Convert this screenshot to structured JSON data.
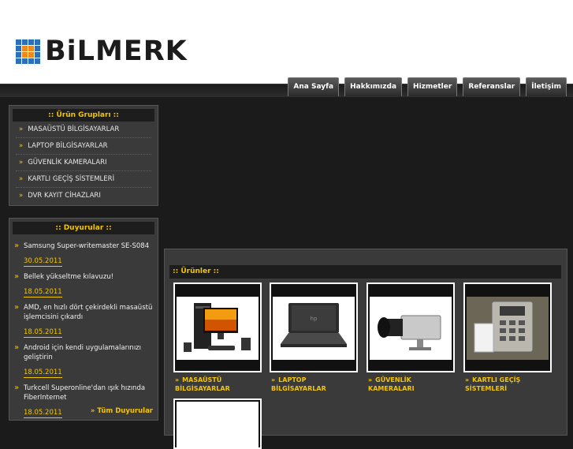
{
  "brand": {
    "name": "BiLMERK"
  },
  "nav": {
    "items": [
      {
        "label": "Ana Sayfa"
      },
      {
        "label": "Hakkımızda"
      },
      {
        "label": "Hizmetler"
      },
      {
        "label": "Referanslar"
      },
      {
        "label": "İletişim"
      }
    ]
  },
  "sidebar": {
    "products_title": ":: Ürün Grupları ::",
    "categories": [
      {
        "label": "MASAÜSTÜ BİLGİSAYARLAR"
      },
      {
        "label": "LAPTOP BİLGİSAYARLAR"
      },
      {
        "label": "GÜVENLİK KAMERALARI"
      },
      {
        "label": "KARTLI GEÇİŞ SİSTEMLERİ"
      },
      {
        "label": "DVR KAYIT CİHAZLARI"
      }
    ],
    "news_title": ":: Duyurular ::",
    "news": [
      {
        "title": "Samsung Super-writemaster SE-S084",
        "date": "30.05.2011"
      },
      {
        "title": "Bellek yükseltme kılavuzu!",
        "date": "18.05.2011"
      },
      {
        "title": "AMD, en hızlı dört çekirdekli masaüstü işlemcisini çıkardı",
        "date": "18.05.2011"
      },
      {
        "title": "Android için kendi uygulamalarınızı geliştirin",
        "date": "18.05.2011"
      },
      {
        "title": "Turkcell Superonline'dan ışık hızında FiberInternet",
        "date": "18.05.2011"
      }
    ],
    "all_news": "» Tüm Duyurular"
  },
  "main": {
    "products_title": ":: Ürünler ::",
    "products": [
      {
        "label": "MASAÜSTÜ BİLGİSAYARLAR",
        "image": "desktop-computer-image"
      },
      {
        "label": "LAPTOP BİLGİSAYARLAR",
        "image": "laptop-image"
      },
      {
        "label": "GÜVENLİK KAMERALARI",
        "image": "security-camera-image"
      },
      {
        "label": "KARTLI GEÇİŞ SİSTEMLERİ",
        "image": "access-control-image"
      },
      {
        "label": "",
        "image": "blank-product-image"
      }
    ]
  },
  "colors": {
    "accent": "#f3c400",
    "panel": "#3a3a3a",
    "background": "#1b1b1b",
    "logo_blue": "#2d6fb8",
    "logo_orange": "#ee8a1c"
  }
}
